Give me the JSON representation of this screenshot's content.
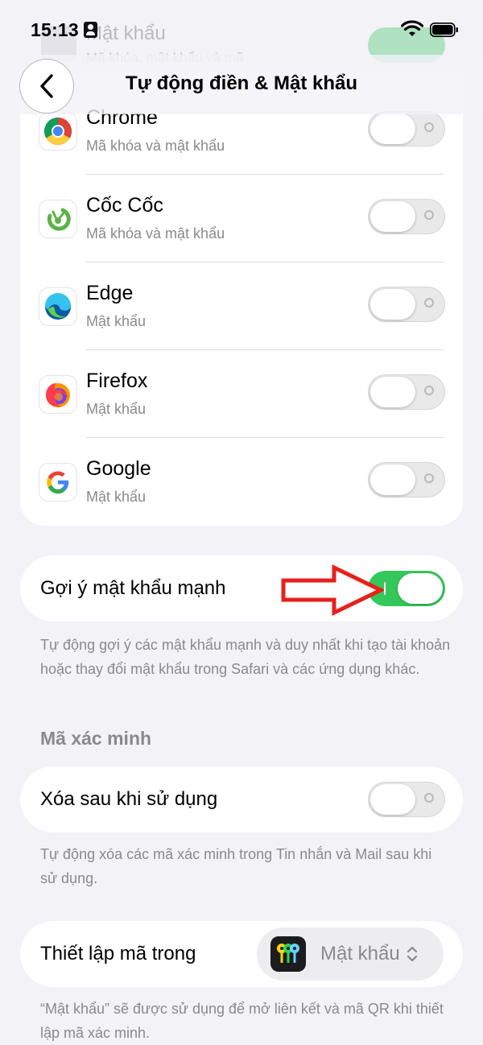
{
  "status_bar": {
    "time": "15:13"
  },
  "header": {
    "title": "Tự động điền & Mật khẩu"
  },
  "ghost_row": {
    "title": "Mật khẩu",
    "subtitle": "Mã khóa, mật khẩu và mã"
  },
  "apps": [
    {
      "name": "Chrome",
      "subtitle": "Mã khóa và mật khẩu",
      "icon": "chrome-icon",
      "enabled": false
    },
    {
      "name": "Cốc Cốc",
      "subtitle": "Mã khóa và mật khẩu",
      "icon": "coccoc-icon",
      "enabled": false
    },
    {
      "name": "Edge",
      "subtitle": "Mật khẩu",
      "icon": "edge-icon",
      "enabled": false
    },
    {
      "name": "Firefox",
      "subtitle": "Mật khẩu",
      "icon": "firefox-icon",
      "enabled": false
    },
    {
      "name": "Google",
      "subtitle": "Mật khẩu",
      "icon": "google-icon",
      "enabled": false
    }
  ],
  "strong_password": {
    "label": "Gợi ý mật khẩu mạnh",
    "enabled": true,
    "footnote": "Tự động gợi ý các mật khẩu mạnh và duy nhất khi tạo tài khoản hoặc thay đổi mật khẩu trong Safari và các ứng dụng khác."
  },
  "verification": {
    "section_title": "Mã xác minh",
    "delete_after_use": {
      "label": "Xóa sau khi sử dụng",
      "enabled": false,
      "footnote": "Tự động xóa các mã xác minh trong Tin nhắn và Mail sau khi sử dụng."
    },
    "setup": {
      "label": "Thiết lập mã trong",
      "selected_app": "Mật khẩu",
      "footnote": "“Mật khẩu” sẽ được sử dụng để mở liên kết và mã QR khi thiết lập mã xác minh."
    }
  },
  "colors": {
    "toggle_on": "#34c759",
    "annotation_arrow": "#e8201c",
    "secondary_text": "#8a8a8e"
  }
}
